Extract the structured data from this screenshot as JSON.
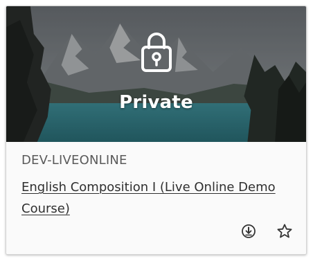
{
  "card": {
    "status": "Private",
    "course_id": "DEV-LIVEONLINE",
    "course_title": "English Composition I (Live Online Demo Course)"
  },
  "icons": {
    "status_icon": "lock-icon",
    "actions": [
      "info-download-icon",
      "star-icon"
    ]
  },
  "colors": {
    "status_text": "#ffffff",
    "course_id_text": "#5a5a5a",
    "title_text": "#2f2f2f",
    "card_bg": "#fafafa"
  }
}
